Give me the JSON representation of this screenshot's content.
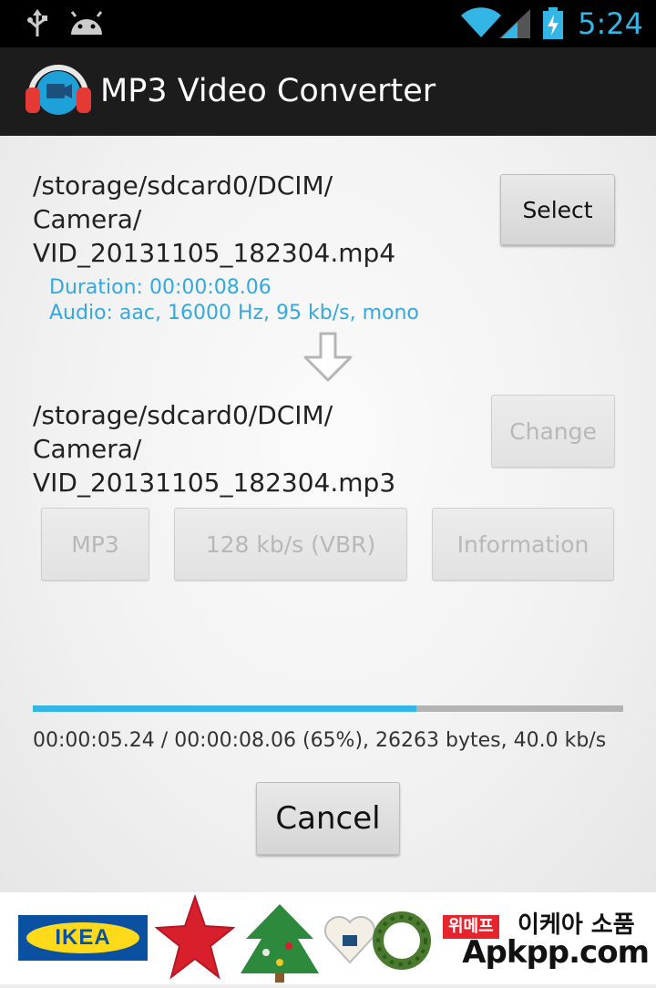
{
  "status_bar": {
    "time": "5:24",
    "icons": [
      "usb-icon",
      "android-icon",
      "wifi-icon",
      "signal-icon",
      "battery-charging-icon"
    ]
  },
  "action_bar": {
    "title": "MP3 Video Converter",
    "icon": "headphones-video-app-icon"
  },
  "source": {
    "path": "/storage/sdcard0/DCIM/\nCamera/\nVID_20131105_182304.mp4",
    "duration": "Duration: 00:00:08.06",
    "audio": "Audio: aac, 16000 Hz, 95 kb/s, mono",
    "select_label": "Select"
  },
  "arrow_icon": "down-arrow-icon",
  "output": {
    "path": "/storage/sdcard0/DCIM/\nCamera/\nVID_20131105_182304.mp3",
    "change_label": "Change",
    "format_label": "MP3",
    "bitrate_label": "128  kb/s (VBR)",
    "information_label": "Information"
  },
  "progress": {
    "fraction": 0.65,
    "text": "00:00:05.24 / 00:00:08.06 (65%), 26263 bytes, 40.0 kb/s",
    "cancel_label": "Cancel"
  },
  "ad": {
    "brand": "IKEA",
    "tag": "위메프",
    "text": "이케아 소품"
  },
  "watermark": "Apkpp.com",
  "colors": {
    "accent": "#33b5e5",
    "info_text": "#33a9df",
    "action_bar": "#1c1c1c",
    "ad_red": "#e5242e"
  }
}
